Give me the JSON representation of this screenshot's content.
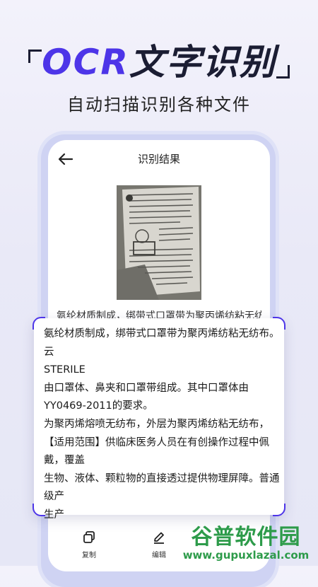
{
  "promo": {
    "title_ocr": "OCR",
    "title_rest": "文字识别",
    "subtitle": "自动扫描识别各种文件"
  },
  "screen": {
    "page_title": "识别结果",
    "background_text_line": "氨纶材质制成，绑带式口罩带为聚丙烯纺粘无纺布"
  },
  "ocr_result": {
    "lines": [
      "氨纶材质制成，绑带式口罩带为聚丙烯纺粘无纺布。",
      "云",
      "STERILE",
      "由口罩体、鼻夹和口罩带组成。其中口罩体由",
      "YY0469-2011的要求。",
      "为聚丙烯熔喷无纺布，外层为聚丙烯纺粘无纺布，",
      "【适用范围】供临床医务人员在有创操作过程中佩",
      "戴，覆盖",
      "生物、液体、颗粒物的直接透过提供物理屏障。普通",
      "级产",
      "生产"
    ]
  },
  "bottom_bar": {
    "copy_label": "复制",
    "edit_label": "编辑"
  },
  "watermark": {
    "main": "谷普软件园",
    "url": "www.gupuxlazal.com"
  },
  "colors": {
    "accent": "#4d35e8",
    "watermark": "#2d9b4a"
  }
}
